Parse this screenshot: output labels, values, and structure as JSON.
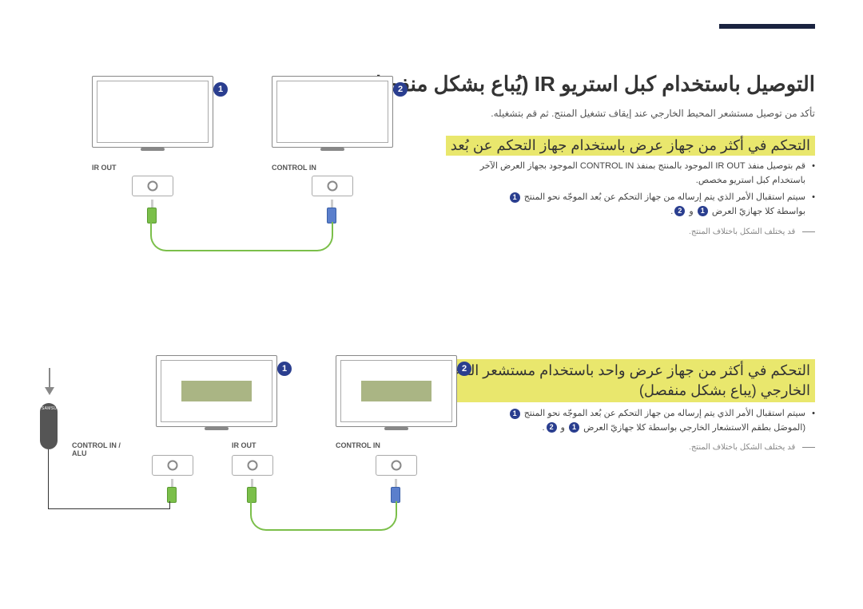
{
  "page_title": "التوصيل باستخدام كبل استريو IR (يُباع بشكل منفصل)",
  "subtitle1": "تأكد من توصيل مستشعر المحيط الخارجي عند إيقاف تشغيل المنتج. ثم قم بتشغيله.",
  "section1": {
    "header": "التحكم في أكثر من جهاز عرض باستخدام جهاز التحكم عن بُعد",
    "bullets": [
      "قم بتوصيل منفذ IR OUT الموجود بالمنتج بمنفذ CONTROL IN الموجود بجهاز العرض الآخر باستخدام كبل استريو مخصص.",
      "سيتم استقبال الأمر الذي يتم إرساله من جهاز التحكم عن بُعد الموجّه نحو المنتج 1 بواسطة كلا جهازيّ العرض 1 و 2."
    ],
    "note": "قد يختلف الشكل باختلاف المنتج."
  },
  "section2": {
    "header_line1": "التحكم في أكثر من جهاز عرض واحد باستخدام مستشعر المحيط",
    "header_line2": "الخارجي (يباع بشكل منفصل)",
    "bullets": [
      "سيتم استقبال الأمر الذي يتم إرساله من جهاز التحكم عن بُعد الموجّه نحو المنتج 1 (الموصَل بطقم الاستشعار الخارجي بواسطة كلا جهازيّ العرض 1 و 2."
    ],
    "note": "قد يختلف الشكل باختلاف المنتج."
  },
  "labels": {
    "ir_out": "IR OUT",
    "control_in": "CONTROL IN",
    "control_in_alu": "CONTROL IN /\nALU",
    "samsung": "SAMSUNG"
  },
  "badges": {
    "one": "1",
    "two": "2"
  }
}
